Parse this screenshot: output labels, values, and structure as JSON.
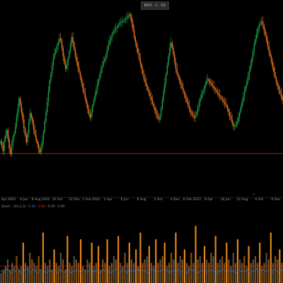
{
  "window": {
    "title_badge": "NDX · 1 · D1"
  },
  "colors": {
    "background": "#000000",
    "candle_up": "#1fa34a",
    "candle_down": "#f07a1f",
    "support_line": "#c0392b",
    "volume_orange": "#f08c1a",
    "volume_gray": "#8c8c8c",
    "oscillator": "#3a7bd5",
    "oscillator_level": "#d93030"
  },
  "time_axis": {
    "labels": [
      "2 Apr 2021",
      "4 Jun",
      "8 Aug 2021",
      "10 Oct",
      "12 Dec",
      "1 Feb 2022",
      "1 Apr",
      "6 Jun",
      "8 Aug",
      "2 Oct",
      "4 Dec",
      "6 Feb 2023",
      "8 Apr",
      "10 Jun",
      "12 Aug",
      "4 Oct",
      "6 Dec"
    ]
  },
  "indicator_legend": {
    "name": "Stoch",
    "params": "(10,3,3)",
    "value_1": "0.00",
    "value_2": "0.00",
    "value_3": "0.00",
    "value_4": "0.00"
  },
  "scroll_marker": "»",
  "chart_data": [
    {
      "type": "candlestick",
      "title": "",
      "series": [
        {
          "name": "",
          "close": [
            63,
            58,
            52,
            64,
            70,
            76,
            66,
            55,
            48,
            58,
            68,
            72,
            80,
            90,
            100,
            112,
            105,
            96,
            88,
            78,
            70,
            62,
            72,
            84,
            95,
            90,
            84,
            76,
            70,
            64,
            60,
            54,
            50,
            56,
            64,
            74,
            86,
            96,
            108,
            120,
            132,
            140,
            150,
            158,
            164,
            168,
            172,
            176,
            181,
            179,
            170,
            160,
            152,
            146,
            150,
            158,
            166,
            174,
            182,
            176,
            168,
            160,
            154,
            148,
            142,
            136,
            130,
            124,
            118,
            112,
            106,
            100,
            94,
            90,
            96,
            104,
            110,
            116,
            122,
            128,
            134,
            140,
            146,
            150,
            154,
            158,
            162,
            168,
            174,
            178,
            182,
            186,
            188,
            190,
            192,
            194,
            196,
            198,
            199,
            200,
            201,
            202,
            203,
            204,
            206,
            208,
            205,
            198,
            190,
            182,
            176,
            170,
            164,
            158,
            152,
            146,
            140,
            134,
            130,
            126,
            122,
            118,
            114,
            110,
            106,
            102,
            98,
            94,
            90,
            88,
            92,
            100,
            110,
            120,
            130,
            140,
            150,
            160,
            170,
            176,
            170,
            162,
            154,
            146,
            140,
            136,
            132,
            128,
            124,
            120,
            116,
            112,
            108,
            104,
            100,
            96,
            94,
            92,
            90,
            92,
            96,
            102,
            108,
            112,
            116,
            120,
            124,
            128,
            132,
            134,
            132,
            130,
            128,
            126,
            124,
            122,
            120,
            118,
            116,
            114,
            112,
            110,
            108,
            106,
            104,
            100,
            96,
            92,
            88,
            84,
            80,
            80,
            82,
            86,
            90,
            96,
            102,
            108,
            114,
            120,
            126,
            132,
            138,
            144,
            150,
            158,
            166,
            174,
            180,
            186,
            192,
            196,
            198,
            200,
            196,
            190,
            184,
            178,
            172,
            166,
            160,
            154,
            148,
            142,
            136,
            130,
            126,
            122,
            118,
            114,
            110
          ]
        }
      ],
      "support_level_present": true
    },
    {
      "type": "bar",
      "title": "",
      "series": [
        {
          "name": "",
          "values": [
            0.15,
            0.2,
            0.25,
            0.35,
            0.2,
            0.3,
            0.25,
            0.4,
            0.2,
            0.25,
            0.6,
            0.3,
            0.25,
            0.45,
            0.35,
            0.3,
            0.25,
            0.4,
            0.2,
            0.75,
            0.3,
            0.25,
            0.35,
            0.2,
            0.5,
            0.3,
            0.25,
            0.45,
            0.35,
            0.2,
            0.7,
            0.3,
            0.25,
            0.4,
            0.35,
            0.3,
            0.65,
            0.25,
            0.2,
            0.35,
            0.3,
            0.6,
            0.25,
            0.3,
            0.55,
            0.2,
            0.35,
            0.3,
            0.65,
            0.25,
            0.3,
            0.4,
            0.35,
            0.7,
            0.3,
            0.25,
            0.45,
            0.3,
            0.6,
            0.35,
            0.3,
            0.5,
            0.25,
            0.75,
            0.3,
            0.35,
            0.4,
            0.55,
            0.3,
            0.25,
            0.65,
            0.3,
            0.35,
            0.4,
            0.6,
            0.25,
            0.3,
            0.45,
            0.35,
            0.75,
            0.3,
            0.4,
            0.35,
            0.5,
            0.3,
            0.25,
            0.45,
            0.3,
            0.85,
            0.35,
            0.4,
            0.3,
            0.55,
            0.35,
            0.3,
            0.45,
            0.4,
            0.7,
            0.3,
            0.35,
            0.4,
            0.3,
            0.6,
            0.35,
            0.25,
            0.45,
            0.3,
            0.65,
            0.35,
            0.3,
            0.4,
            0.25,
            0.55,
            0.3,
            0.35,
            0.4,
            0.3,
            0.6,
            0.25,
            0.3,
            0.45,
            0.35,
            0.75,
            0.3,
            0.4,
            0.35,
            0.5,
            0.3
          ]
        }
      ]
    },
    {
      "type": "line",
      "title": "",
      "series": [
        {
          "name": "",
          "values": [
            0.35,
            0.4,
            0.32,
            0.45,
            0.38,
            0.3,
            0.42,
            0.36,
            0.5,
            0.34,
            0.28,
            0.4,
            0.46,
            0.38,
            0.32,
            0.44,
            0.36,
            0.3,
            0.42,
            0.48,
            0.36,
            0.3,
            0.4,
            0.34,
            0.46,
            0.38,
            0.3,
            0.42,
            0.36,
            0.32,
            0.45,
            0.38,
            0.3,
            0.4,
            0.35,
            0.44,
            0.3,
            0.38,
            0.42,
            0.34,
            0.36,
            0.46,
            0.32,
            0.4,
            0.38,
            0.3,
            0.44,
            0.36,
            0.42,
            0.34,
            0.3,
            0.4,
            0.46,
            0.36,
            0.32,
            0.42,
            0.38,
            0.3,
            0.44,
            0.36,
            0.4,
            0.34,
            0.46,
            0.32,
            0.38,
            0.42,
            0.3,
            0.36,
            0.44,
            0.4,
            0.34,
            0.38,
            0.32,
            0.46,
            0.36,
            0.42,
            0.3,
            0.4,
            0.38,
            0.34,
            0.44,
            0.32,
            0.4,
            0.36,
            0.3,
            0.46,
            0.38,
            0.42,
            0.34,
            0.3,
            0.4,
            0.36,
            0.44,
            0.32,
            0.38,
            0.42,
            0.36,
            0.3,
            0.4,
            0.34,
            0.46,
            0.38,
            0.32,
            0.42,
            0.36,
            0.4,
            0.3,
            0.44,
            0.36,
            0.38,
            0.34,
            0.42,
            0.3,
            0.4,
            0.36,
            0.46,
            0.32,
            0.38,
            0.42,
            0.34,
            0.4,
            0.36,
            0.3,
            0.44,
            0.38,
            0.34,
            0.42,
            0.36
          ]
        }
      ],
      "reference_level_present": true
    }
  ]
}
